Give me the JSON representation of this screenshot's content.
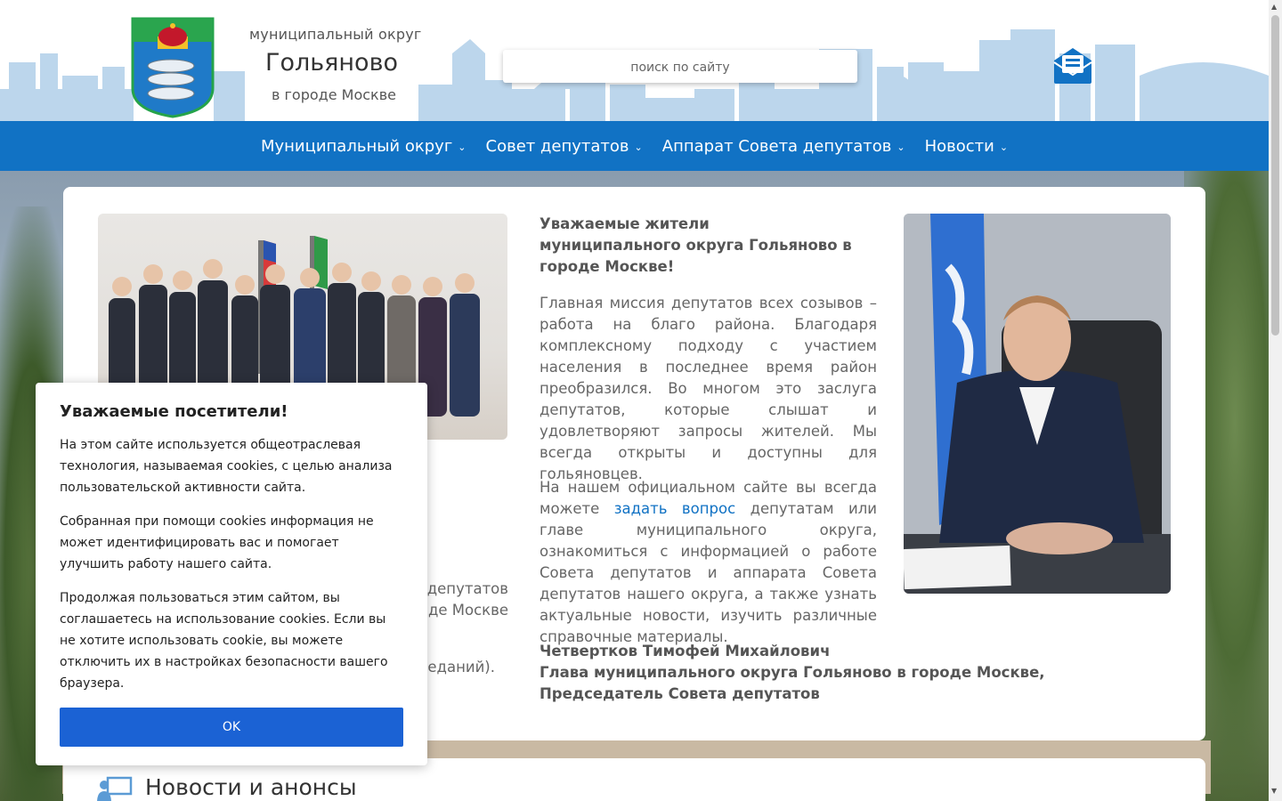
{
  "header": {
    "title_top": "муниципальный округ",
    "title_main": "Гольяново",
    "title_bottom": "в городе Москве",
    "search_placeholder": "поиск по сайту"
  },
  "nav": {
    "items": [
      {
        "label": "Муниципальный округ"
      },
      {
        "label": "Совет депутатов"
      },
      {
        "label": "Аппарат Совета депутатов"
      },
      {
        "label": "Новости"
      }
    ]
  },
  "main": {
    "greeting_line1": "Уважаемые жители",
    "greeting_line2": "муниципального округа Гольяново в городе Москве!",
    "paragraph1": "Главная миссия депутатов всех созывов – работа на благо района. Благодаря комплексному подходу с участием населения в последнее время район преобразился. Во многом это заслуга депутатов, которые слышат и удовлетворяют запросы жителей. Мы всегда открыты и доступны для гольяновцев.",
    "paragraph2_before": "На нашем официальном сайте вы всегда можете ",
    "paragraph2_link": "задать вопрос",
    "paragraph2_after": " депутатам или главе муниципального округа, ознакомиться с информацией о работе Совета депутатов и аппарата Совета депутатов нашего округа, а также узнать актуальные новости, изучить различные справочные материалы.",
    "signature_name": "Четвертков Тимофей Михайлович",
    "signature_position": "Глава муниципального округа Гольяново в городе Москве, Председатель Совета депутатов",
    "left_fragment1": "депутатов",
    "left_fragment2": "де Москве",
    "left_fragment3": "седаний)."
  },
  "news": {
    "title": "Новости и анонсы"
  },
  "cookie": {
    "title": "Уважаемые посетители!",
    "p1": "На этом сайте используется общеотраслевая технология, называемая cookies, с целью анализа пользовательской активности сайта.",
    "p2": "Собранная при помощи cookies информация не может идентифицировать вас и помогает улучшить работу нашего сайта.",
    "p3": "Продолжая пользоваться этим сайтом, вы соглашаетесь на использование cookies. Если вы не хотите использовать cookie, вы можете отключить их в настройках безопасности вашего браузера.",
    "ok_label": "OK"
  },
  "colors": {
    "nav_blue": "#1172c4",
    "skyline_blue": "#bcd6ec",
    "button_blue": "#1b62d4"
  },
  "icons": {
    "mail": "mail-envelope-icon",
    "chevron": "chevron-down-icon",
    "news": "presentation-icon"
  }
}
